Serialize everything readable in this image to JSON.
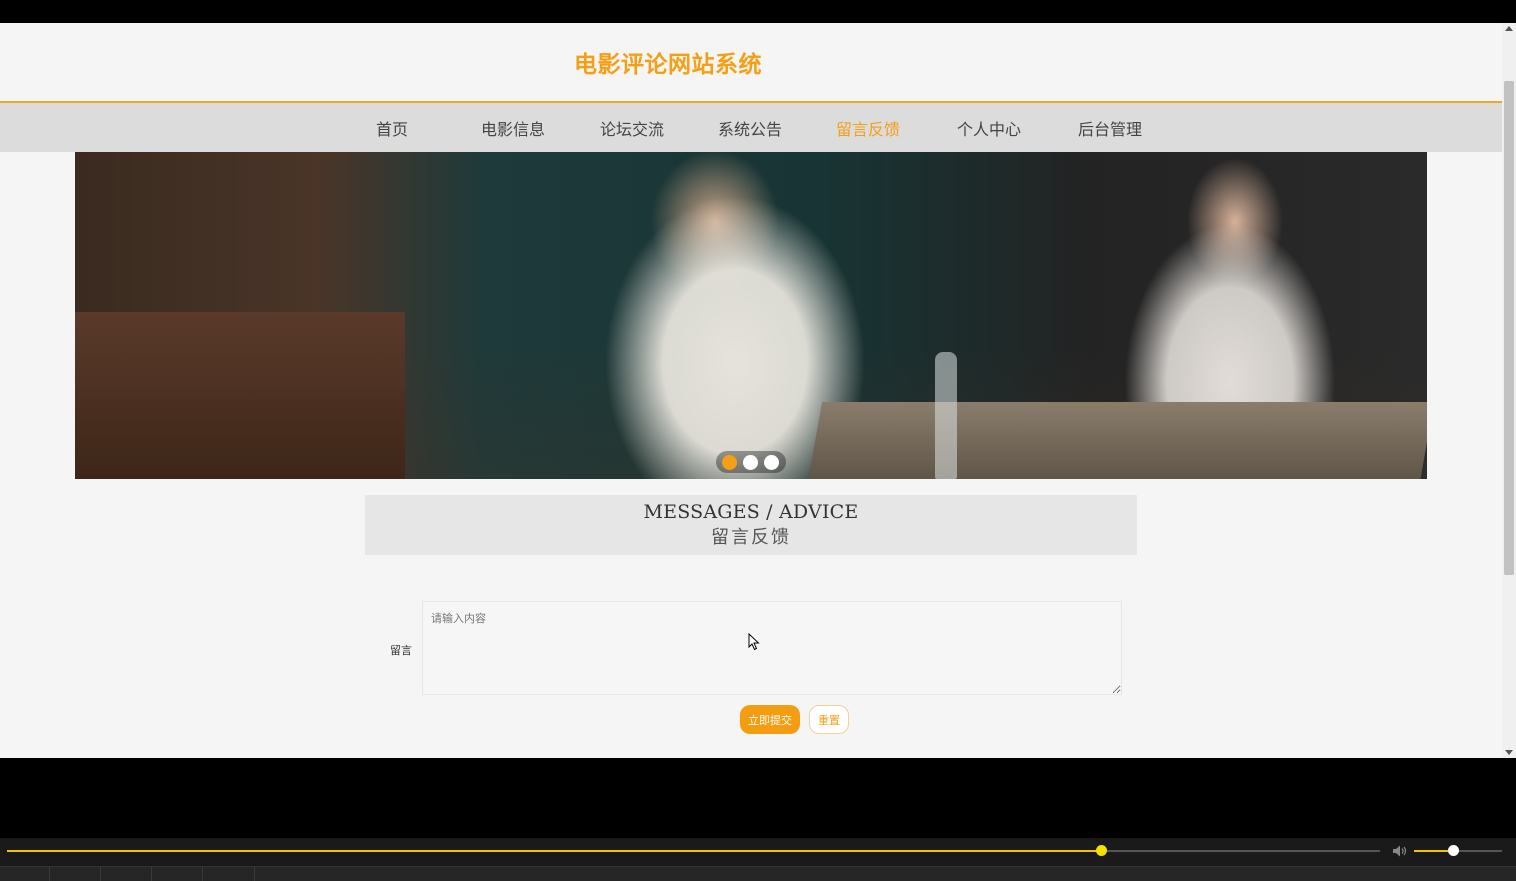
{
  "site": {
    "title": "电影评论网站系统"
  },
  "nav": {
    "items": [
      {
        "label": "首页",
        "active": false
      },
      {
        "label": "电影信息",
        "active": false
      },
      {
        "label": "论坛交流",
        "active": false
      },
      {
        "label": "系统公告",
        "active": false
      },
      {
        "label": "留言反馈",
        "active": true
      },
      {
        "label": "个人中心",
        "active": false
      },
      {
        "label": "后台管理",
        "active": false
      }
    ]
  },
  "carousel": {
    "slide_count": 3,
    "active_index": 0
  },
  "section": {
    "title_en": "MESSAGES / ADVICE",
    "title_cn": "留言反馈"
  },
  "form": {
    "label": "留言",
    "placeholder": "请输入内容",
    "value": "",
    "submit_label": "立即提交",
    "reset_label": "重置"
  },
  "player": {
    "progress_fraction": 0.797,
    "volume_fraction": 0.44
  },
  "colors": {
    "accent": "#f49f16",
    "nav_bg": "#dcdcdc",
    "page_bg": "#f5f5f5"
  }
}
